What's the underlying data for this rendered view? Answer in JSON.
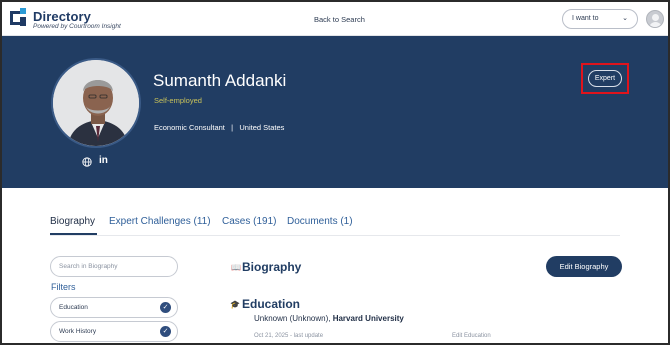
{
  "header": {
    "brand_title": "Directory",
    "brand_subtitle": "Powered by Courtroom Insight",
    "back_link": "Back to Search",
    "want_to_label": "I want to"
  },
  "profile": {
    "name": "Sumanth Addanki",
    "employer": "Self-employed",
    "role": "Economic Consultant",
    "separator": "|",
    "country": "United States",
    "linkedin_label": "in",
    "expert_button": "Expert"
  },
  "tabs": [
    {
      "label": "Biography",
      "active": true
    },
    {
      "label": "Expert Challenges (11)",
      "active": false
    },
    {
      "label": "Cases (191)",
      "active": false
    },
    {
      "label": "Documents (1)",
      "active": false
    }
  ],
  "sidebar": {
    "search_placeholder": "Search in Biography",
    "filters_heading": "Filters",
    "filters": [
      {
        "label": "Education",
        "checked": true
      },
      {
        "label": "Work History",
        "checked": true
      }
    ]
  },
  "content": {
    "biography_heading": "Biography",
    "edit_biography_button": "Edit Biography",
    "education_heading": "Education",
    "education_entry_prefix": "Unknown (Unknown), ",
    "education_entry_school": "Harvard University",
    "education_meta": "Oct 21, 2025 - last update",
    "education_edit_link": "Edit Education"
  },
  "colors": {
    "hero_background": "#213d63",
    "accent_blue": "#2f5f99",
    "employer_text": "#c9c25a",
    "highlight_red": "#e0141c"
  }
}
